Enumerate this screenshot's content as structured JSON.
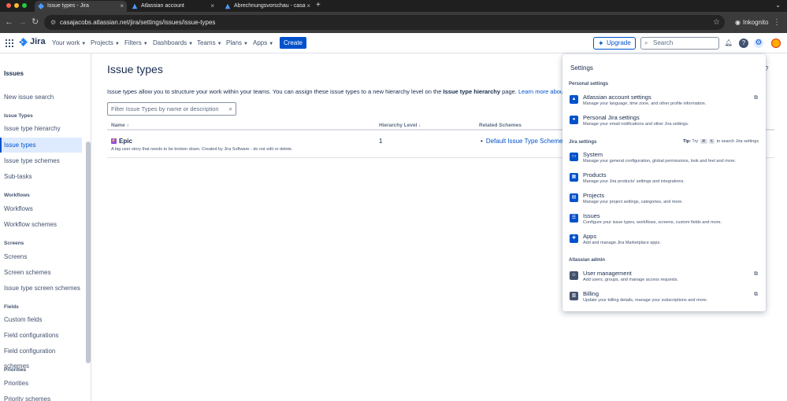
{
  "browser": {
    "tabs": [
      {
        "title": "Issue types - Jira",
        "close": "×"
      },
      {
        "title": "Atlassian account",
        "close": "×"
      },
      {
        "title": "Abrechnungsvorschau - casa",
        "close": "×"
      }
    ],
    "new_tab": "+",
    "url": "casajacobs.atlassian.net/jira/settings/issues/issue-types",
    "profile": "Inkognito"
  },
  "topnav": {
    "logo_text": "Jira",
    "menus": [
      "Your work",
      "Projects",
      "Filters",
      "Dashboards",
      "Teams",
      "Plans",
      "Apps"
    ],
    "create_label": "Create",
    "upgrade_label": "Upgrade",
    "search_placeholder": "Search"
  },
  "sidebar": {
    "title": "Issues",
    "items": [
      {
        "type": "item",
        "label": "New issue search"
      },
      {
        "type": "head",
        "label": "Issue Types"
      },
      {
        "type": "item",
        "label": "Issue type hierarchy"
      },
      {
        "type": "item",
        "label": "Issue types",
        "selected": true
      },
      {
        "type": "item",
        "label": "Issue type schemes"
      },
      {
        "type": "item",
        "label": "Sub-tasks"
      },
      {
        "type": "head",
        "label": "Workflows"
      },
      {
        "type": "item",
        "label": "Workflows"
      },
      {
        "type": "item",
        "label": "Workflow schemes"
      },
      {
        "type": "head",
        "label": "Screens"
      },
      {
        "type": "item",
        "label": "Screens"
      },
      {
        "type": "item",
        "label": "Screen schemes"
      },
      {
        "type": "item",
        "label": "Issue type screen schemes"
      },
      {
        "type": "head",
        "label": "Fields"
      },
      {
        "type": "item",
        "label": "Custom fields"
      },
      {
        "type": "item",
        "label": "Field configurations"
      },
      {
        "type": "item",
        "label": "Field configuration schemes"
      },
      {
        "type": "head",
        "label": "Priorities"
      },
      {
        "type": "item",
        "label": "Priorities"
      },
      {
        "type": "item",
        "label": "Priority schemes"
      }
    ]
  },
  "main": {
    "title": "Issue types",
    "help": "?",
    "description_pre": "Issue types allow you to structure your work within your teams. You can assign these issue types to a new hierarchy level on the ",
    "description_bold": "Issue type hierarchy",
    "description_mid": " page. ",
    "description_link": "Learn more about issue",
    "filter_placeholder": "Filter Issue Types by name or description",
    "columns": {
      "name": "Name",
      "name_sort": "↕",
      "hierarchy": "Hierarchy Level",
      "hierarchy_sort": "↓",
      "schemes": "Related Schemes"
    },
    "rows": [
      {
        "name": "Epic",
        "description": "A big user story that needs to be broken down. Created by Jira Software - do not edit or delete.",
        "level": "1",
        "scheme": "Default Issue Type Scheme"
      }
    ]
  },
  "settings_panel": {
    "title": "Settings",
    "personal_heading": "Personal settings",
    "personal": [
      {
        "title": "Atlassian account settings",
        "desc": "Manage your language, time zone, and other profile information.",
        "external": true
      },
      {
        "title": "Personal Jira settings",
        "desc": "Manage your email notifications and other Jira settings.",
        "external": false
      }
    ],
    "jira_heading": "Jira settings",
    "tip": {
      "label": "Tip:",
      "pre": "Try",
      "k1": "⌘",
      "k2": "K",
      "post": "to search Jira settings"
    },
    "jira": [
      {
        "title": "System",
        "desc": "Manage your general configuration, global permissions, look and feel and more."
      },
      {
        "title": "Products",
        "desc": "Manage your Jira products' settings and integrations."
      },
      {
        "title": "Projects",
        "desc": "Manage your project settings, categories, and more."
      },
      {
        "title": "Issues",
        "desc": "Configure your issue types, workflows, screens, custom fields and more."
      },
      {
        "title": "Apps",
        "desc": "Add and manage Jira Marketplace apps."
      }
    ],
    "admin_heading": "Atlassian admin",
    "admin": [
      {
        "title": "User management",
        "desc": "Add users, groups, and manage access requests.",
        "external": true
      },
      {
        "title": "Billing",
        "desc": "Update your billing details, manage your subscriptions and more.",
        "external": true
      }
    ]
  },
  "colors": {
    "brand": "#0052cc",
    "epic": "#904ee2",
    "selected_bg": "#deebff"
  }
}
